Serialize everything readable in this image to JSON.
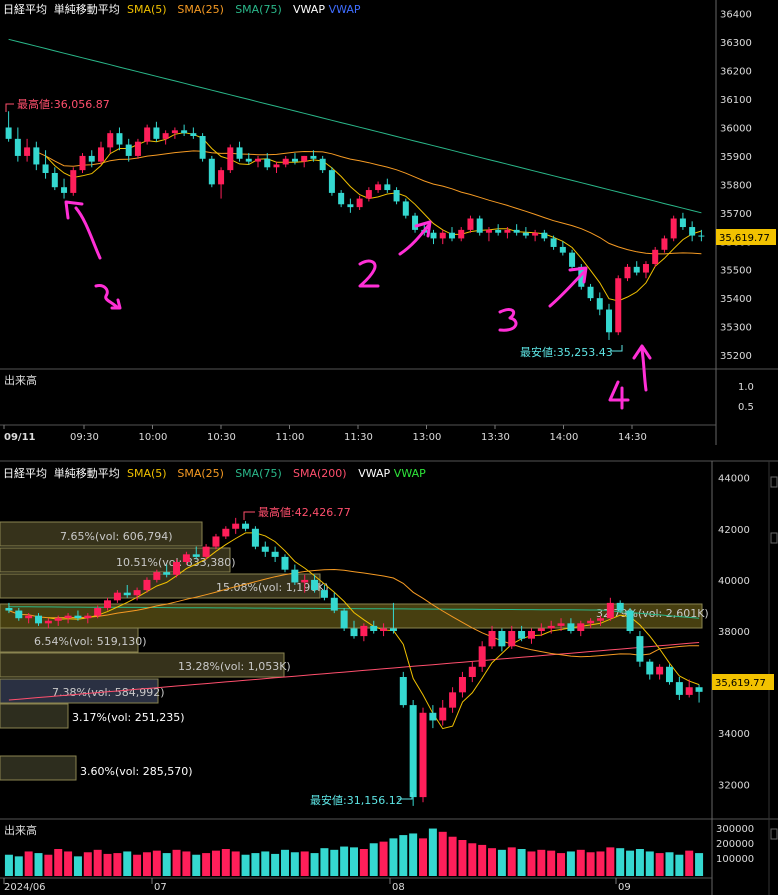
{
  "chart_data": [
    {
      "type": "candlestick",
      "interval": "1 minute (intraday)",
      "legend": {
        "items": [
          {
            "label": "日経平均",
            "color": "#ffffff"
          },
          {
            "label": "単純移動平均",
            "color": "#ffffff"
          },
          {
            "label": "SMA(5)",
            "color": "#f0c000"
          },
          {
            "label": "SMA(25)",
            "color": "#f59a23"
          },
          {
            "label": "SMA(75)",
            "color": "#2ab88a"
          },
          {
            "label": "VWAP",
            "color": "#ffffff"
          },
          {
            "label": "VWAP",
            "color": "#3f6dff"
          }
        ]
      },
      "y_ticks": [
        36400,
        36300,
        36200,
        36100,
        36000,
        35900,
        35800,
        35700,
        35600,
        35500,
        35400,
        35300,
        35200
      ],
      "ylim": [
        35165,
        36420
      ],
      "x_ticks": [
        "09/11",
        "09:30",
        "10:00",
        "10:30",
        "11:00",
        "11:30",
        "13:00",
        "13:30",
        "14:00",
        "14:30"
      ],
      "last_price": "35,619.77",
      "high_label": "最高値:36,056.87",
      "low_label": "最安値:35,253.43",
      "volume_label": "出来高",
      "volume_ticks": [
        "1.0",
        "0.5"
      ],
      "candles": [
        [
          36000,
          36057,
          35950,
          35960
        ],
        [
          35960,
          36000,
          35880,
          35900
        ],
        [
          35900,
          35960,
          35880,
          35930
        ],
        [
          35930,
          35950,
          35850,
          35870
        ],
        [
          35870,
          35920,
          35820,
          35840
        ],
        [
          35840,
          35860,
          35780,
          35790
        ],
        [
          35790,
          35820,
          35750,
          35770
        ],
        [
          35770,
          35860,
          35760,
          35850
        ],
        [
          35850,
          35910,
          35840,
          35900
        ],
        [
          35900,
          35920,
          35860,
          35880
        ],
        [
          35880,
          35950,
          35870,
          35930
        ],
        [
          35930,
          35990,
          35910,
          35980
        ],
        [
          35980,
          36000,
          35920,
          35940
        ],
        [
          35940,
          35960,
          35880,
          35900
        ],
        [
          35900,
          35960,
          35890,
          35950
        ],
        [
          35950,
          36010,
          35940,
          36000
        ],
        [
          36000,
          36020,
          35950,
          35960
        ],
        [
          35960,
          35990,
          35940,
          35980
        ],
        [
          35980,
          36000,
          35960,
          35990
        ],
        [
          35990,
          36010,
          35970,
          35980
        ],
        [
          35980,
          36000,
          35960,
          35970
        ],
        [
          35970,
          35980,
          35880,
          35890
        ],
        [
          35890,
          35900,
          35790,
          35800
        ],
        [
          35800,
          35860,
          35750,
          35850
        ],
        [
          35850,
          35940,
          35840,
          35930
        ],
        [
          35930,
          35950,
          35880,
          35890
        ],
        [
          35890,
          35910,
          35870,
          35880
        ],
        [
          35880,
          35900,
          35860,
          35890
        ],
        [
          35890,
          35910,
          35850,
          35860
        ],
        [
          35860,
          35880,
          35840,
          35870
        ],
        [
          35870,
          35900,
          35860,
          35890
        ],
        [
          35890,
          35910,
          35870,
          35880
        ],
        [
          35880,
          35900,
          35860,
          35900
        ],
        [
          35900,
          35920,
          35880,
          35890
        ],
        [
          35890,
          35900,
          35840,
          35850
        ],
        [
          35850,
          35860,
          35760,
          35770
        ],
        [
          35770,
          35780,
          35720,
          35730
        ],
        [
          35730,
          35750,
          35700,
          35720
        ],
        [
          35720,
          35760,
          35710,
          35750
        ],
        [
          35750,
          35790,
          35740,
          35780
        ],
        [
          35780,
          35810,
          35770,
          35800
        ],
        [
          35800,
          35820,
          35770,
          35780
        ],
        [
          35780,
          35790,
          35730,
          35740
        ],
        [
          35740,
          35750,
          35680,
          35690
        ],
        [
          35690,
          35700,
          35630,
          35640
        ],
        [
          35640,
          35660,
          35620,
          35630
        ],
        [
          35630,
          35640,
          35590,
          35610
        ],
        [
          35610,
          35640,
          35590,
          35630
        ],
        [
          35630,
          35650,
          35600,
          35610
        ],
        [
          35610,
          35650,
          35600,
          35640
        ],
        [
          35640,
          35690,
          35630,
          35680
        ],
        [
          35680,
          35690,
          35620,
          35630
        ],
        [
          35630,
          35650,
          35600,
          35640
        ],
        [
          35640,
          35660,
          35620,
          35630
        ],
        [
          35630,
          35650,
          35610,
          35640
        ],
        [
          35640,
          35660,
          35620,
          35630
        ],
        [
          35630,
          35650,
          35610,
          35620
        ],
        [
          35620,
          35640,
          35600,
          35630
        ],
        [
          35630,
          35640,
          35600,
          35610
        ],
        [
          35610,
          35620,
          35570,
          35580
        ],
        [
          35580,
          35600,
          35550,
          35560
        ],
        [
          35560,
          35570,
          35500,
          35510
        ],
        [
          35510,
          35520,
          35430,
          35440
        ],
        [
          35440,
          35450,
          35390,
          35400
        ],
        [
          35400,
          35420,
          35340,
          35360
        ],
        [
          35360,
          35380,
          35253,
          35280
        ],
        [
          35280,
          35480,
          35270,
          35470
        ],
        [
          35470,
          35520,
          35460,
          35510
        ],
        [
          35510,
          35530,
          35480,
          35490
        ],
        [
          35490,
          35530,
          35470,
          35520
        ],
        [
          35520,
          35580,
          35510,
          35570
        ],
        [
          35570,
          35620,
          35560,
          35610
        ],
        [
          35610,
          35690,
          35600,
          35680
        ],
        [
          35680,
          35700,
          35640,
          35650
        ],
        [
          35650,
          35670,
          35600,
          35620
        ],
        [
          35620,
          35640,
          35600,
          35619.77
        ]
      ]
    },
    {
      "type": "candlestick",
      "interval": "daily",
      "legend": {
        "items": [
          {
            "label": "日経平均",
            "color": "#ffffff"
          },
          {
            "label": "単純移動平均",
            "color": "#ffffff"
          },
          {
            "label": "SMA(5)",
            "color": "#f0c000"
          },
          {
            "label": "SMA(25)",
            "color": "#f59a23"
          },
          {
            "label": "SMA(75)",
            "color": "#2ab88a"
          },
          {
            "label": "SMA(200)",
            "color": "#ff4f6d"
          },
          {
            "label": "VWAP",
            "color": "#ffffff"
          },
          {
            "label": "VWAP",
            "color": "#2ee63a"
          }
        ]
      },
      "y_ticks": [
        44000,
        42000,
        40000,
        38000,
        36000,
        34000,
        32000
      ],
      "ylim": [
        30800,
        44300
      ],
      "x_ticks": [
        "2024/06",
        "07",
        "08",
        "09"
      ],
      "last_price": "35,619.77",
      "high_label": "最高値:42,426.77",
      "low_label": "最安値:31,156.12",
      "volume_label": "出来高",
      "volume_ticks": [
        "300000",
        "200000",
        "100000"
      ],
      "volume_profile": [
        {
          "label": "7.65%(vol: 606,794)"
        },
        {
          "label": "10.51%(vol: 833,380)"
        },
        {
          "label": "15.08%(vol: 1,196K)"
        },
        {
          "label": "32.79%(vol: 2,601K)"
        },
        {
          "label": "6.54%(vol: 519,130)"
        },
        {
          "label": "13.28%(vol: 1,053K)"
        },
        {
          "label": "7.38%(vol: 584,992)"
        },
        {
          "label": "3.17%(vol: 251,235)"
        },
        {
          "label": "3.60%(vol: 285,570)"
        }
      ],
      "candles": [
        [
          38900,
          39100,
          38700,
          38800
        ],
        [
          38800,
          38900,
          38400,
          38500
        ],
        [
          38500,
          38700,
          38300,
          38600
        ],
        [
          38600,
          38700,
          38200,
          38300
        ],
        [
          38300,
          38500,
          38100,
          38400
        ],
        [
          38400,
          38600,
          38200,
          38500
        ],
        [
          38500,
          38700,
          38300,
          38600
        ],
        [
          38600,
          38800,
          38400,
          38500
        ],
        [
          38500,
          38700,
          38300,
          38600
        ],
        [
          38600,
          39000,
          38500,
          38900
        ],
        [
          38900,
          39300,
          38800,
          39200
        ],
        [
          39200,
          39600,
          39100,
          39500
        ],
        [
          39500,
          39800,
          39300,
          39400
        ],
        [
          39400,
          39700,
          39200,
          39600
        ],
        [
          39600,
          40100,
          39500,
          40000
        ],
        [
          40000,
          40400,
          39900,
          40300
        ],
        [
          40300,
          40600,
          40100,
          40200
        ],
        [
          40200,
          40800,
          40100,
          40700
        ],
        [
          40700,
          41100,
          40600,
          41000
        ],
        [
          41000,
          41300,
          40800,
          40900
        ],
        [
          40900,
          41400,
          40800,
          41300
        ],
        [
          41300,
          41800,
          41200,
          41700
        ],
        [
          41700,
          42100,
          41600,
          42000
        ],
        [
          42000,
          42426.77,
          41800,
          42200
        ],
        [
          42200,
          42300,
          41900,
          42000
        ],
        [
          42000,
          42100,
          41200,
          41300
        ],
        [
          41300,
          41500,
          40900,
          41100
        ],
        [
          41100,
          41300,
          40700,
          40900
        ],
        [
          40900,
          41000,
          40300,
          40400
        ],
        [
          40400,
          40600,
          39800,
          39900
        ],
        [
          39900,
          40200,
          39500,
          40000
        ],
        [
          40000,
          40200,
          39500,
          39600
        ],
        [
          39600,
          39800,
          39200,
          39300
        ],
        [
          39300,
          39500,
          38700,
          38800
        ],
        [
          38800,
          38900,
          38000,
          38100
        ],
        [
          38100,
          38400,
          37700,
          37800
        ],
        [
          37800,
          38300,
          37600,
          38200
        ],
        [
          38200,
          38400,
          37900,
          38000
        ],
        [
          38000,
          38300,
          37800,
          38100
        ],
        [
          38100,
          39100,
          37900,
          38000
        ],
        [
          36200,
          36400,
          35000,
          35100
        ],
        [
          35100,
          35300,
          31156.12,
          31500
        ],
        [
          31500,
          35000,
          31300,
          34800
        ],
        [
          34800,
          35100,
          34200,
          34500
        ],
        [
          34500,
          35300,
          34300,
          35000
        ],
        [
          35000,
          35800,
          34800,
          35600
        ],
        [
          35600,
          36400,
          35400,
          36200
        ],
        [
          36200,
          36800,
          36000,
          36600
        ],
        [
          36600,
          37600,
          36400,
          37400
        ],
        [
          37400,
          38200,
          37300,
          38000
        ],
        [
          38000,
          38100,
          37200,
          37400
        ],
        [
          37400,
          38200,
          37300,
          38000
        ],
        [
          38000,
          38200,
          37600,
          37700
        ],
        [
          37700,
          38100,
          37500,
          38000
        ],
        [
          38000,
          38300,
          37800,
          38100
        ],
        [
          38100,
          38400,
          37900,
          38200
        ],
        [
          38200,
          38500,
          38000,
          38300
        ],
        [
          38300,
          38500,
          37900,
          38000
        ],
        [
          38000,
          38400,
          37800,
          38300
        ],
        [
          38300,
          38500,
          38100,
          38400
        ],
        [
          38400,
          38600,
          38200,
          38500
        ],
        [
          38500,
          39300,
          38400,
          39100
        ],
        [
          39100,
          39200,
          38700,
          38800
        ],
        [
          38800,
          38900,
          37900,
          38000
        ],
        [
          37800,
          38000,
          36600,
          36800
        ],
        [
          36800,
          36900,
          36100,
          36300
        ],
        [
          36300,
          36700,
          36100,
          36600
        ],
        [
          36600,
          36700,
          35900,
          36000
        ],
        [
          36000,
          36200,
          35300,
          35500
        ],
        [
          35500,
          36100,
          35400,
          35800
        ],
        [
          35800,
          35900,
          35200,
          35619.77
        ]
      ],
      "volume": [
        130000,
        120000,
        150000,
        140000,
        130000,
        165000,
        150000,
        120000,
        145000,
        160000,
        135000,
        140000,
        150000,
        130000,
        145000,
        155000,
        140000,
        160000,
        150000,
        130000,
        140000,
        155000,
        165000,
        150000,
        130000,
        140000,
        150000,
        135000,
        160000,
        145000,
        150000,
        140000,
        170000,
        160000,
        180000,
        175000,
        165000,
        200000,
        210000,
        230000,
        250000,
        260000,
        230000,
        290000,
        270000,
        240000,
        220000,
        200000,
        190000,
        170000,
        160000,
        175000,
        165000,
        150000,
        160000,
        155000,
        140000,
        150000,
        160000,
        145000,
        150000,
        175000,
        170000,
        155000,
        165000,
        150000,
        140000,
        145000,
        130000,
        155000,
        140000
      ]
    }
  ]
}
